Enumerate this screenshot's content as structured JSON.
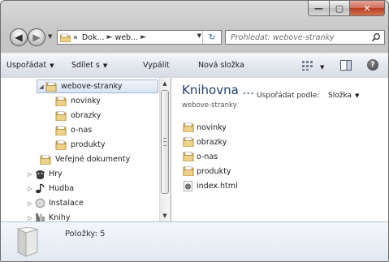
{
  "window": {
    "minimize_glyph": "—",
    "maximize_glyph": "▢",
    "close_glyph": "✕"
  },
  "navigation": {
    "back_glyph": "◀",
    "forward_glyph": "▶",
    "history_dropdown_glyph": "▼",
    "breadcrumb": [
      "«",
      "Dok...",
      "web...",
      ""
    ],
    "breadcrumb_separator": "►",
    "refresh_glyph": "↻",
    "address_dropdown_glyph": "▼"
  },
  "search": {
    "placeholder": "Prohledat: webove-stranky"
  },
  "toolbar": {
    "organize_label": "Uspořádat",
    "share_label": "Sdílet s",
    "burn_label": "Vypálit",
    "new_folder_label": "Nová složka",
    "help_glyph": "?"
  },
  "nav_tree": {
    "items": [
      {
        "label": "webove-stranky",
        "icon": "folder-icon",
        "expanded": true,
        "selected": true
      },
      {
        "label": "novinky",
        "icon": "folder-icon"
      },
      {
        "label": "obrazky",
        "icon": "folder-icon"
      },
      {
        "label": "o-nas",
        "icon": "folder-icon"
      },
      {
        "label": "produkty",
        "icon": "folder-icon"
      },
      {
        "label": "Veřejné dokumenty",
        "icon": "folder-icon"
      },
      {
        "label": "Hry",
        "icon": "games-icon"
      },
      {
        "label": "Hudba",
        "icon": "music-icon"
      },
      {
        "label": "Instalace",
        "icon": "disc-icon"
      },
      {
        "label": "Knihy",
        "icon": "books-icon"
      }
    ],
    "expand_glyph": "▷",
    "collapse_glyph": "◢"
  },
  "content": {
    "library_title": "Knihovna ...",
    "library_subtitle": "webove-stranky",
    "arrange_by_label": "Uspořádat podle:",
    "arrange_by_value": "Složka",
    "files": [
      {
        "name": "novinky",
        "icon": "folder-icon"
      },
      {
        "name": "obrazky",
        "icon": "folder-icon"
      },
      {
        "name": "o-nas",
        "icon": "folder-icon"
      },
      {
        "name": "produkty",
        "icon": "folder-icon"
      },
      {
        "name": "index.html",
        "icon": "html-file-icon"
      }
    ]
  },
  "details": {
    "item_count_label": "Položky: 5"
  },
  "colors": {
    "folder": "#e3c16f",
    "folder_dark": "#b8913a",
    "accent_title": "#1e3e6e",
    "selection": "#d8e3f2"
  }
}
